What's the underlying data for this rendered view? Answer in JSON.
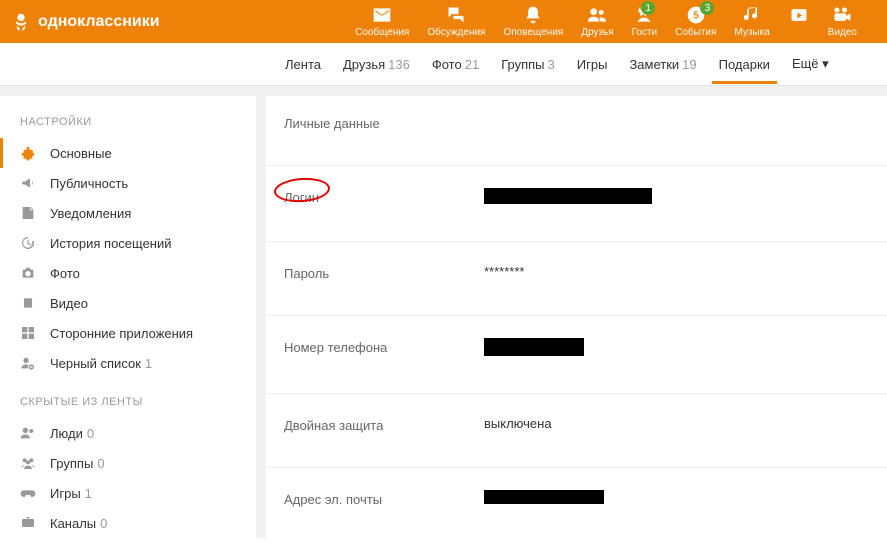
{
  "brand": "одноклассники",
  "topIcons": {
    "messages": "Сообщения",
    "discussions": "Обсуждения",
    "notifications": "Оповещения",
    "friends": "Друзья",
    "guests": "Гости",
    "events": "События",
    "music": "Музыка",
    "video": "Видео",
    "guestsBadge": "1",
    "eventsBadge": "3"
  },
  "tabs": {
    "feed": "Лента",
    "friends": "Друзья",
    "friendsCount": "136",
    "photo": "Фото",
    "photoCount": "21",
    "groups": "Группы",
    "groupsCount": "3",
    "games": "Игры",
    "notes": "Заметки",
    "notesCount": "19",
    "gifts": "Подарки",
    "more": "Ещё ▾"
  },
  "sidebar": {
    "settingsTitle": "НАСТРОЙКИ",
    "hiddenTitle": "СКРЫТЫЕ ИЗ ЛЕНТЫ",
    "items": {
      "general": "Основные",
      "publicity": "Публичность",
      "notifications": "Уведомления",
      "history": "История посещений",
      "photo": "Фото",
      "video": "Видео",
      "apps": "Сторонние приложения",
      "blacklist": "Черный список",
      "blacklistCount": "1",
      "people": "Люди",
      "peopleCount": "0",
      "groups": "Группы",
      "groupsCount": "0",
      "games": "Игры",
      "gamesCount": "1",
      "channels": "Каналы",
      "channelsCount": "0"
    }
  },
  "settings": {
    "personal": "Личные данные",
    "login": "Логин",
    "password": "Пароль",
    "passwordValue": "********",
    "phone": "Номер телефона",
    "twofa": "Двойная защита",
    "twofaValue": "выключена",
    "email": "Адрес эл. почты"
  }
}
